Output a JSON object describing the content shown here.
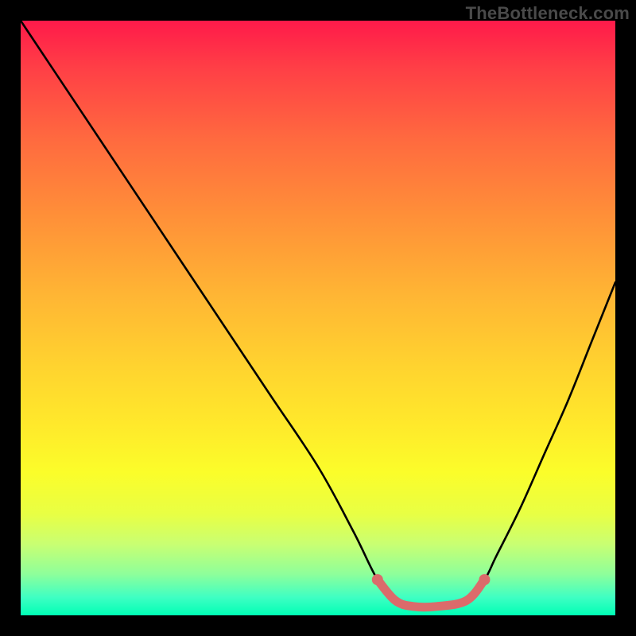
{
  "watermark": "TheBottleneck.com",
  "chart_data": {
    "type": "line",
    "title": "",
    "xlabel": "",
    "ylabel": "",
    "xlim": [
      0,
      100
    ],
    "ylim": [
      0,
      100
    ],
    "series": [
      {
        "name": "bottleneck-curve",
        "color": "#000000",
        "x": [
          0,
          4,
          10,
          18,
          26,
          34,
          42,
          50,
          56,
          60,
          63,
          66,
          70,
          75,
          78,
          80,
          84,
          88,
          92,
          96,
          100
        ],
        "y": [
          100,
          94,
          85,
          73,
          61,
          49,
          37,
          25,
          14,
          6,
          2.5,
          1.5,
          1.5,
          2.5,
          6,
          10,
          18,
          27,
          36,
          46,
          56
        ]
      },
      {
        "name": "highlight-band",
        "color": "#e06666",
        "x": [
          60,
          63,
          66,
          70,
          75,
          78
        ],
        "y": [
          6,
          2.5,
          1.5,
          1.5,
          2.5,
          6
        ]
      }
    ],
    "background_gradient": {
      "top": "#ff1a4a",
      "bottom": "#00ffb5"
    }
  }
}
